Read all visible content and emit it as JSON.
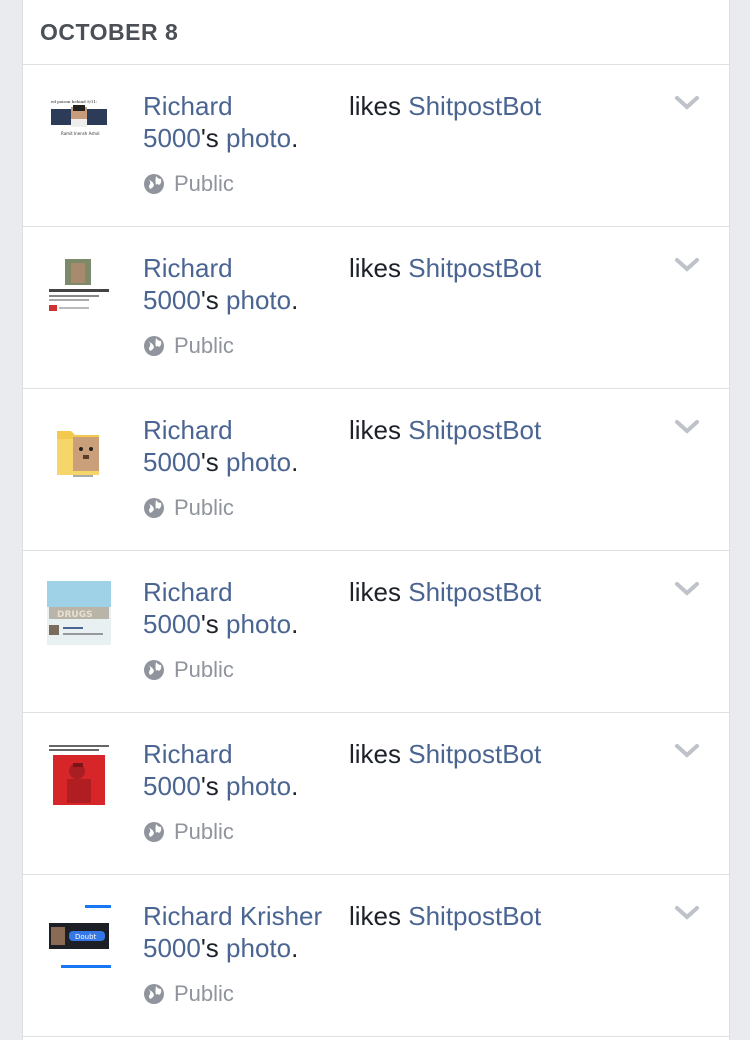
{
  "section": {
    "date_label": "OCTOBER 8"
  },
  "icons": {
    "privacy": "globe-icon",
    "menu": "chevron-down-icon"
  },
  "colors": {
    "link": "#4b6593",
    "meta": "#90949c",
    "text": "#1d2129"
  },
  "items": [
    {
      "actor": "Richard",
      "verb": "likes",
      "target": "ShitpostBot",
      "target_cont": "5000",
      "possessive": "'s",
      "object": "photo",
      "period": ".",
      "privacy": "Public",
      "thumb": {
        "kind": "meme-portrait",
        "caption_top": "ed poison behind 9/11:",
        "caption_bottom": "Ramit Inensh Ashol"
      }
    },
    {
      "actor": "Richard",
      "verb": "likes",
      "target": "ShitpostBot",
      "target_cont": "5000",
      "possessive": "'s",
      "object": "photo",
      "period": ".",
      "privacy": "Public",
      "thumb": {
        "kind": "screenshot-post"
      }
    },
    {
      "actor": "Richard",
      "verb": "likes",
      "target": "ShitpostBot",
      "target_cont": "5000",
      "possessive": "'s",
      "object": "photo",
      "period": ".",
      "privacy": "Public",
      "thumb": {
        "kind": "folder-dog"
      }
    },
    {
      "actor": "Richard",
      "verb": "likes",
      "target": "ShitpostBot",
      "target_cont": "5000",
      "possessive": "'s",
      "object": "photo",
      "period": ".",
      "privacy": "Public",
      "thumb": {
        "kind": "drugs-sign",
        "sign_text": "DRUGS"
      }
    },
    {
      "actor": "Richard",
      "verb": "likes",
      "target": "ShitpostBot",
      "target_cont": "5000",
      "possessive": "'s",
      "object": "photo",
      "period": ".",
      "privacy": "Public",
      "thumb": {
        "kind": "red-soldier"
      }
    },
    {
      "actor": "Richard Krisher",
      "verb": "likes",
      "target": "ShitpostBot",
      "target_cont": "5000",
      "possessive": "'s",
      "object": "photo",
      "period": ".",
      "privacy": "Public",
      "thumb": {
        "kind": "doubt-meme",
        "badge_text": "Doubt"
      }
    }
  ]
}
